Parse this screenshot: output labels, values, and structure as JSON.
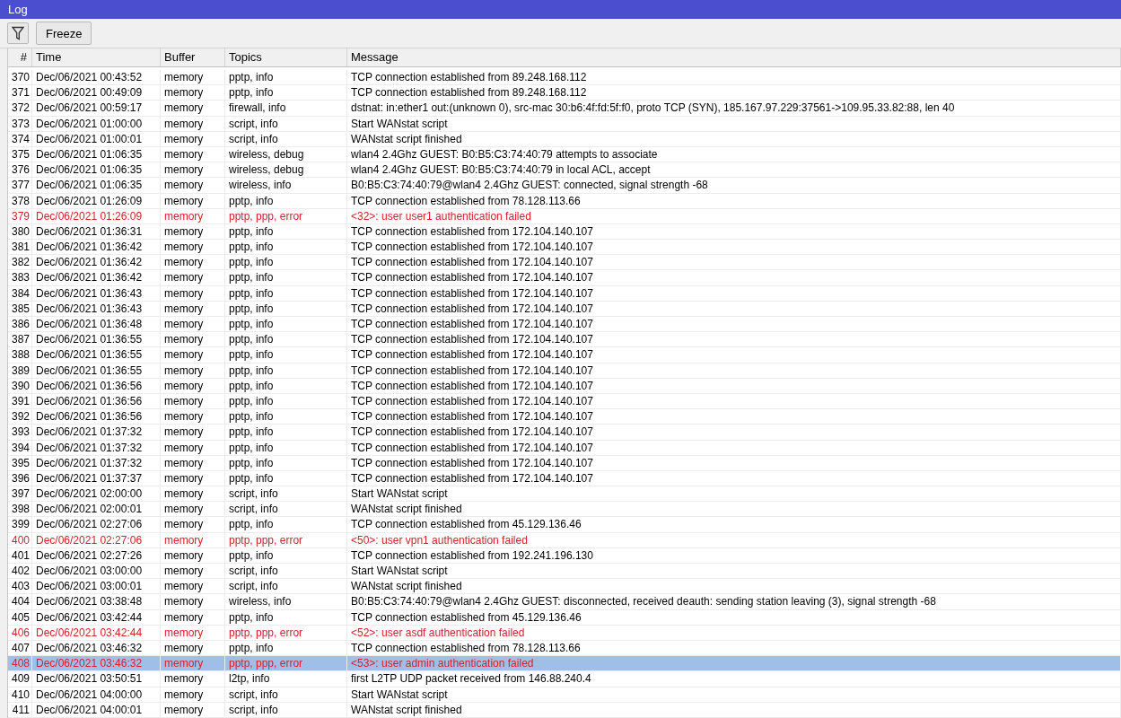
{
  "window": {
    "title": "Log"
  },
  "toolbar": {
    "freeze_button": "Freeze"
  },
  "table": {
    "columns": [
      "#",
      "Time",
      "Buffer",
      "Topics",
      "Message"
    ],
    "rows": [
      {
        "num": "370",
        "time": "Dec/06/2021 00:43:52",
        "buffer": "memory",
        "topics": "pptp, info",
        "message": "TCP connection established from 89.248.168.112",
        "error": false,
        "selected": false
      },
      {
        "num": "371",
        "time": "Dec/06/2021 00:49:09",
        "buffer": "memory",
        "topics": "pptp, info",
        "message": "TCP connection established from 89.248.168.112",
        "error": false,
        "selected": false
      },
      {
        "num": "372",
        "time": "Dec/06/2021 00:59:17",
        "buffer": "memory",
        "topics": "firewall, info",
        "message": "dstnat: in:ether1 out:(unknown 0), src-mac 30:b6:4f:fd:5f:f0, proto TCP (SYN), 185.167.97.229:37561->109.95.33.82:88, len 40",
        "error": false,
        "selected": false
      },
      {
        "num": "373",
        "time": "Dec/06/2021 01:00:00",
        "buffer": "memory",
        "topics": "script, info",
        "message": "Start WANstat script",
        "error": false,
        "selected": false
      },
      {
        "num": "374",
        "time": "Dec/06/2021 01:00:01",
        "buffer": "memory",
        "topics": "script, info",
        "message": "WANstat script finished",
        "error": false,
        "selected": false
      },
      {
        "num": "375",
        "time": "Dec/06/2021 01:06:35",
        "buffer": "memory",
        "topics": "wireless, debug",
        "message": "wlan4 2.4Ghz GUEST: B0:B5:C3:74:40:79 attempts to associate",
        "error": false,
        "selected": false
      },
      {
        "num": "376",
        "time": "Dec/06/2021 01:06:35",
        "buffer": "memory",
        "topics": "wireless, debug",
        "message": "wlan4 2.4Ghz GUEST: B0:B5:C3:74:40:79 in local ACL, accept",
        "error": false,
        "selected": false
      },
      {
        "num": "377",
        "time": "Dec/06/2021 01:06:35",
        "buffer": "memory",
        "topics": "wireless, info",
        "message": "B0:B5:C3:74:40:79@wlan4 2.4Ghz GUEST: connected, signal strength -68",
        "error": false,
        "selected": false
      },
      {
        "num": "378",
        "time": "Dec/06/2021 01:26:09",
        "buffer": "memory",
        "topics": "pptp, info",
        "message": "TCP connection established from 78.128.113.66",
        "error": false,
        "selected": false
      },
      {
        "num": "379",
        "time": "Dec/06/2021 01:26:09",
        "buffer": "memory",
        "topics": "pptp, ppp, error",
        "message": "<32>: user user1 authentication failed",
        "error": true,
        "selected": false
      },
      {
        "num": "380",
        "time": "Dec/06/2021 01:36:31",
        "buffer": "memory",
        "topics": "pptp, info",
        "message": "TCP connection established from 172.104.140.107",
        "error": false,
        "selected": false
      },
      {
        "num": "381",
        "time": "Dec/06/2021 01:36:42",
        "buffer": "memory",
        "topics": "pptp, info",
        "message": "TCP connection established from 172.104.140.107",
        "error": false,
        "selected": false
      },
      {
        "num": "382",
        "time": "Dec/06/2021 01:36:42",
        "buffer": "memory",
        "topics": "pptp, info",
        "message": "TCP connection established from 172.104.140.107",
        "error": false,
        "selected": false
      },
      {
        "num": "383",
        "time": "Dec/06/2021 01:36:42",
        "buffer": "memory",
        "topics": "pptp, info",
        "message": "TCP connection established from 172.104.140.107",
        "error": false,
        "selected": false
      },
      {
        "num": "384",
        "time": "Dec/06/2021 01:36:43",
        "buffer": "memory",
        "topics": "pptp, info",
        "message": "TCP connection established from 172.104.140.107",
        "error": false,
        "selected": false
      },
      {
        "num": "385",
        "time": "Dec/06/2021 01:36:43",
        "buffer": "memory",
        "topics": "pptp, info",
        "message": "TCP connection established from 172.104.140.107",
        "error": false,
        "selected": false
      },
      {
        "num": "386",
        "time": "Dec/06/2021 01:36:48",
        "buffer": "memory",
        "topics": "pptp, info",
        "message": "TCP connection established from 172.104.140.107",
        "error": false,
        "selected": false
      },
      {
        "num": "387",
        "time": "Dec/06/2021 01:36:55",
        "buffer": "memory",
        "topics": "pptp, info",
        "message": "TCP connection established from 172.104.140.107",
        "error": false,
        "selected": false
      },
      {
        "num": "388",
        "time": "Dec/06/2021 01:36:55",
        "buffer": "memory",
        "topics": "pptp, info",
        "message": "TCP connection established from 172.104.140.107",
        "error": false,
        "selected": false
      },
      {
        "num": "389",
        "time": "Dec/06/2021 01:36:55",
        "buffer": "memory",
        "topics": "pptp, info",
        "message": "TCP connection established from 172.104.140.107",
        "error": false,
        "selected": false
      },
      {
        "num": "390",
        "time": "Dec/06/2021 01:36:56",
        "buffer": "memory",
        "topics": "pptp, info",
        "message": "TCP connection established from 172.104.140.107",
        "error": false,
        "selected": false
      },
      {
        "num": "391",
        "time": "Dec/06/2021 01:36:56",
        "buffer": "memory",
        "topics": "pptp, info",
        "message": "TCP connection established from 172.104.140.107",
        "error": false,
        "selected": false
      },
      {
        "num": "392",
        "time": "Dec/06/2021 01:36:56",
        "buffer": "memory",
        "topics": "pptp, info",
        "message": "TCP connection established from 172.104.140.107",
        "error": false,
        "selected": false
      },
      {
        "num": "393",
        "time": "Dec/06/2021 01:37:32",
        "buffer": "memory",
        "topics": "pptp, info",
        "message": "TCP connection established from 172.104.140.107",
        "error": false,
        "selected": false
      },
      {
        "num": "394",
        "time": "Dec/06/2021 01:37:32",
        "buffer": "memory",
        "topics": "pptp, info",
        "message": "TCP connection established from 172.104.140.107",
        "error": false,
        "selected": false
      },
      {
        "num": "395",
        "time": "Dec/06/2021 01:37:32",
        "buffer": "memory",
        "topics": "pptp, info",
        "message": "TCP connection established from 172.104.140.107",
        "error": false,
        "selected": false
      },
      {
        "num": "396",
        "time": "Dec/06/2021 01:37:37",
        "buffer": "memory",
        "topics": "pptp, info",
        "message": "TCP connection established from 172.104.140.107",
        "error": false,
        "selected": false
      },
      {
        "num": "397",
        "time": "Dec/06/2021 02:00:00",
        "buffer": "memory",
        "topics": "script, info",
        "message": "Start WANstat script",
        "error": false,
        "selected": false
      },
      {
        "num": "398",
        "time": "Dec/06/2021 02:00:01",
        "buffer": "memory",
        "topics": "script, info",
        "message": "WANstat script finished",
        "error": false,
        "selected": false
      },
      {
        "num": "399",
        "time": "Dec/06/2021 02:27:06",
        "buffer": "memory",
        "topics": "pptp, info",
        "message": "TCP connection established from 45.129.136.46",
        "error": false,
        "selected": false
      },
      {
        "num": "400",
        "time": "Dec/06/2021 02:27:06",
        "buffer": "memory",
        "topics": "pptp, ppp, error",
        "message": "<50>: user vpn1 authentication failed",
        "error": true,
        "selected": false
      },
      {
        "num": "401",
        "time": "Dec/06/2021 02:27:26",
        "buffer": "memory",
        "topics": "pptp, info",
        "message": "TCP connection established from 192.241.196.130",
        "error": false,
        "selected": false
      },
      {
        "num": "402",
        "time": "Dec/06/2021 03:00:00",
        "buffer": "memory",
        "topics": "script, info",
        "message": "Start WANstat script",
        "error": false,
        "selected": false
      },
      {
        "num": "403",
        "time": "Dec/06/2021 03:00:01",
        "buffer": "memory",
        "topics": "script, info",
        "message": "WANstat script finished",
        "error": false,
        "selected": false
      },
      {
        "num": "404",
        "time": "Dec/06/2021 03:38:48",
        "buffer": "memory",
        "topics": "wireless, info",
        "message": "B0:B5:C3:74:40:79@wlan4 2.4Ghz GUEST: disconnected, received deauth: sending station leaving (3), signal strength -68",
        "error": false,
        "selected": false
      },
      {
        "num": "405",
        "time": "Dec/06/2021 03:42:44",
        "buffer": "memory",
        "topics": "pptp, info",
        "message": "TCP connection established from 45.129.136.46",
        "error": false,
        "selected": false
      },
      {
        "num": "406",
        "time": "Dec/06/2021 03:42:44",
        "buffer": "memory",
        "topics": "pptp, ppp, error",
        "message": "<52>: user asdf authentication failed",
        "error": true,
        "selected": false
      },
      {
        "num": "407",
        "time": "Dec/06/2021 03:46:32",
        "buffer": "memory",
        "topics": "pptp, info",
        "message": "TCP connection established from 78.128.113.66",
        "error": false,
        "selected": false
      },
      {
        "num": "408",
        "time": "Dec/06/2021 03:46:32",
        "buffer": "memory",
        "topics": "pptp, ppp, error",
        "message": "<53>: user admin authentication failed",
        "error": true,
        "selected": true
      },
      {
        "num": "409",
        "time": "Dec/06/2021 03:50:51",
        "buffer": "memory",
        "topics": "l2tp, info",
        "message": "first L2TP UDP packet received from 146.88.240.4",
        "error": false,
        "selected": false
      },
      {
        "num": "410",
        "time": "Dec/06/2021 04:00:00",
        "buffer": "memory",
        "topics": "script, info",
        "message": "Start WANstat script",
        "error": false,
        "selected": false
      },
      {
        "num": "411",
        "time": "Dec/06/2021 04:00:01",
        "buffer": "memory",
        "topics": "script, info",
        "message": "WANstat script finished",
        "error": false,
        "selected": false
      }
    ]
  }
}
